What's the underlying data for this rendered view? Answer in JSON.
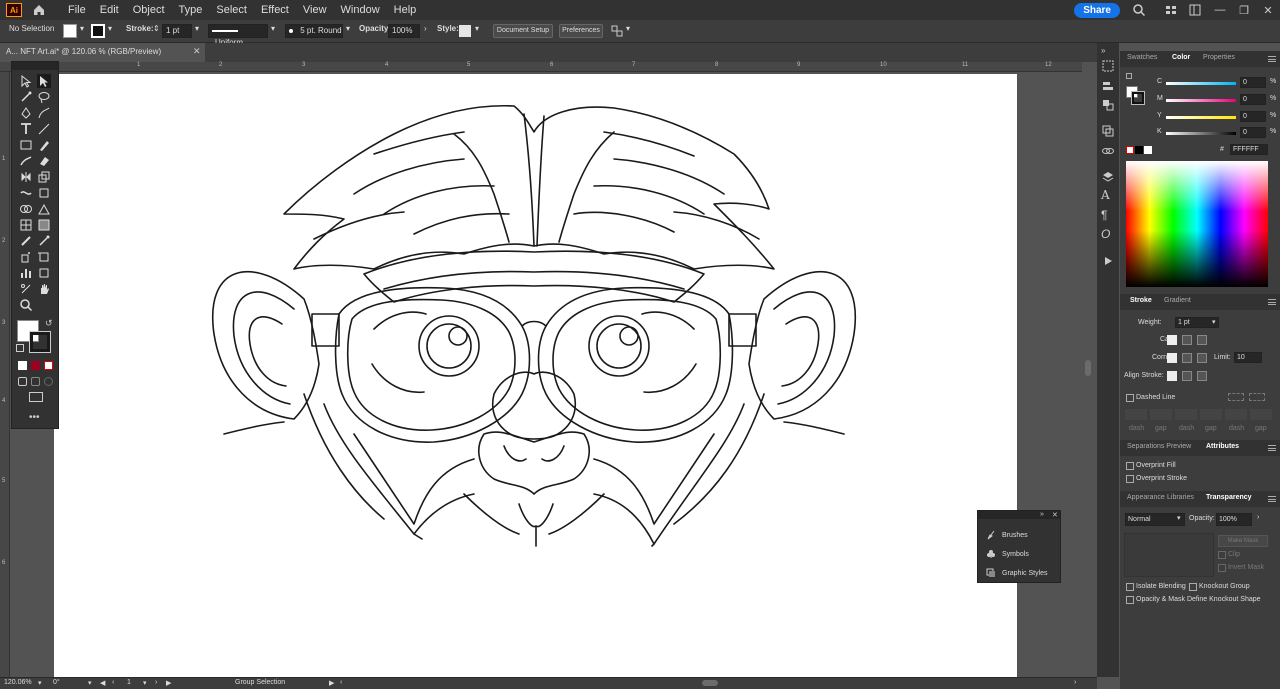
{
  "menubar": {
    "logo": "Ai",
    "items": [
      "File",
      "Edit",
      "Object",
      "Type",
      "Select",
      "Effect",
      "View",
      "Window",
      "Help"
    ],
    "share_label": "Share"
  },
  "controlbar": {
    "selection": "No Selection",
    "stroke_label": "Stroke:",
    "stroke_weight": "1 pt",
    "profile": "Uniform",
    "brush": "5 pt. Round",
    "opacity_label": "Opacity:",
    "opacity_value": "100%",
    "style_label": "Style:",
    "document_setup": "Document Setup",
    "preferences": "Preferences"
  },
  "document": {
    "tab_title": "A... NFT Art.ai* @ 120.06 % (RGB/Preview)",
    "ruler_h": [
      "1",
      "2",
      "3",
      "4",
      "5",
      "6",
      "7",
      "8",
      "9",
      "10",
      "11",
      "12"
    ],
    "ruler_v": [
      "1",
      "2",
      "3",
      "4",
      "5",
      "6"
    ]
  },
  "statusbar": {
    "zoom": "120.06%",
    "rotation": "0°",
    "artboard": "1",
    "status": "Group Selection"
  },
  "color_panel": {
    "tabs": [
      "Swatches",
      "Color",
      "Properties"
    ],
    "active_tab": "Color",
    "channels": [
      {
        "label": "C",
        "value": "0",
        "unit": "%",
        "color": "#00b4f0"
      },
      {
        "label": "M",
        "value": "0",
        "unit": "%",
        "color": "#e6007e"
      },
      {
        "label": "Y",
        "value": "0",
        "unit": "%",
        "color": "#ffe600"
      },
      {
        "label": "K",
        "value": "0",
        "unit": "%",
        "color": "#cccccc"
      }
    ],
    "hex_prefix": "#",
    "hex": "FFFFFF"
  },
  "stroke_panel": {
    "tabs": [
      "Stroke",
      "Gradient"
    ],
    "weight_label": "Weight:",
    "weight": "1 pt",
    "cap_label": "Cap:",
    "corner_label": "Corner:",
    "limit_label": "Limit:",
    "limit": "10",
    "align_label": "Align Stroke:",
    "dashed_label": "Dashed Line",
    "dash_fields": [
      "dash",
      "gap",
      "dash",
      "gap",
      "dash",
      "gap"
    ]
  },
  "attributes_panel": {
    "tabs": [
      "Separations Preview",
      "Attributes"
    ],
    "overprint_fill": "Overprint Fill",
    "overprint_stroke": "Overprint Stroke"
  },
  "transparency_panel": {
    "tabs": [
      "Appearance",
      "Libraries",
      "Transparency"
    ],
    "blend_mode": "Normal",
    "opacity_label": "Opacity:",
    "opacity": "100%",
    "make_mask": "Make Mask",
    "clip": "Clip",
    "invert_mask": "Invert Mask",
    "isolate": "Isolate Blending",
    "knockout": "Knockout Group",
    "opacity_mask": "Opacity & Mask Define Knockout Shape"
  },
  "float_panel": {
    "items": [
      "Brushes",
      "Symbols",
      "Graphic Styles"
    ]
  }
}
